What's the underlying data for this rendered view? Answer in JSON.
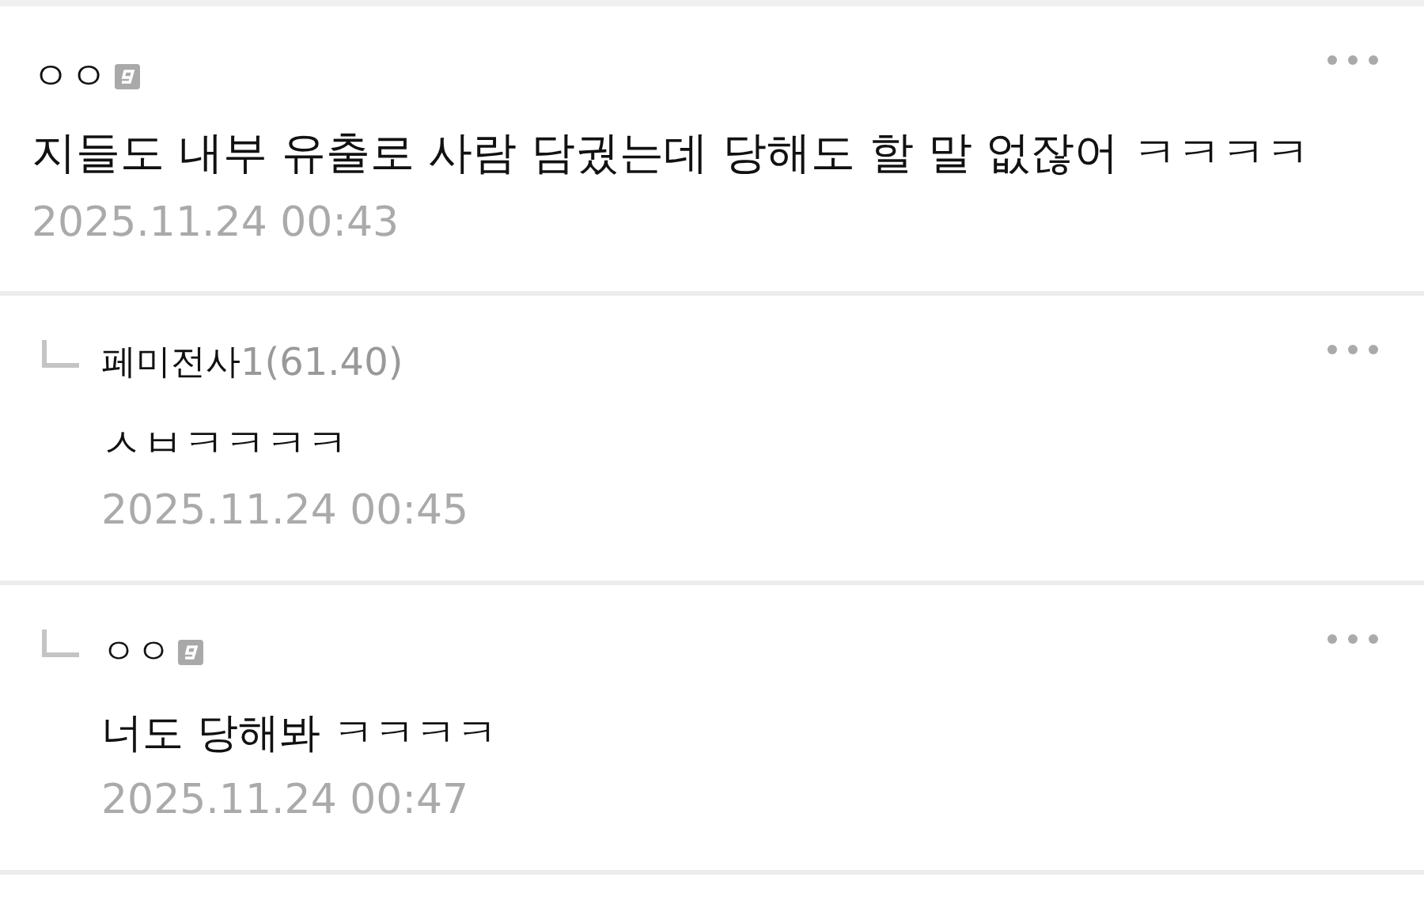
{
  "comments": [
    {
      "kind": "comment",
      "author": "ㅇㅇ",
      "guest": true,
      "text": "지들도 내부 유출로 사람 담궜는데 당해도 할 말 없잖어 ㅋㅋㅋㅋ",
      "date": "2025.11.24 00:43"
    },
    {
      "kind": "reply",
      "author": "페미전사",
      "author_info": "1(61.40)",
      "guest": false,
      "text": "ㅅㅂㅋㅋㅋㅋ",
      "date": "2025.11.24 00:45"
    },
    {
      "kind": "reply",
      "author": "ㅇㅇ",
      "guest": true,
      "text": "너도 당해봐 ㅋㅋㅋㅋ",
      "date": "2025.11.24 00:47"
    }
  ]
}
